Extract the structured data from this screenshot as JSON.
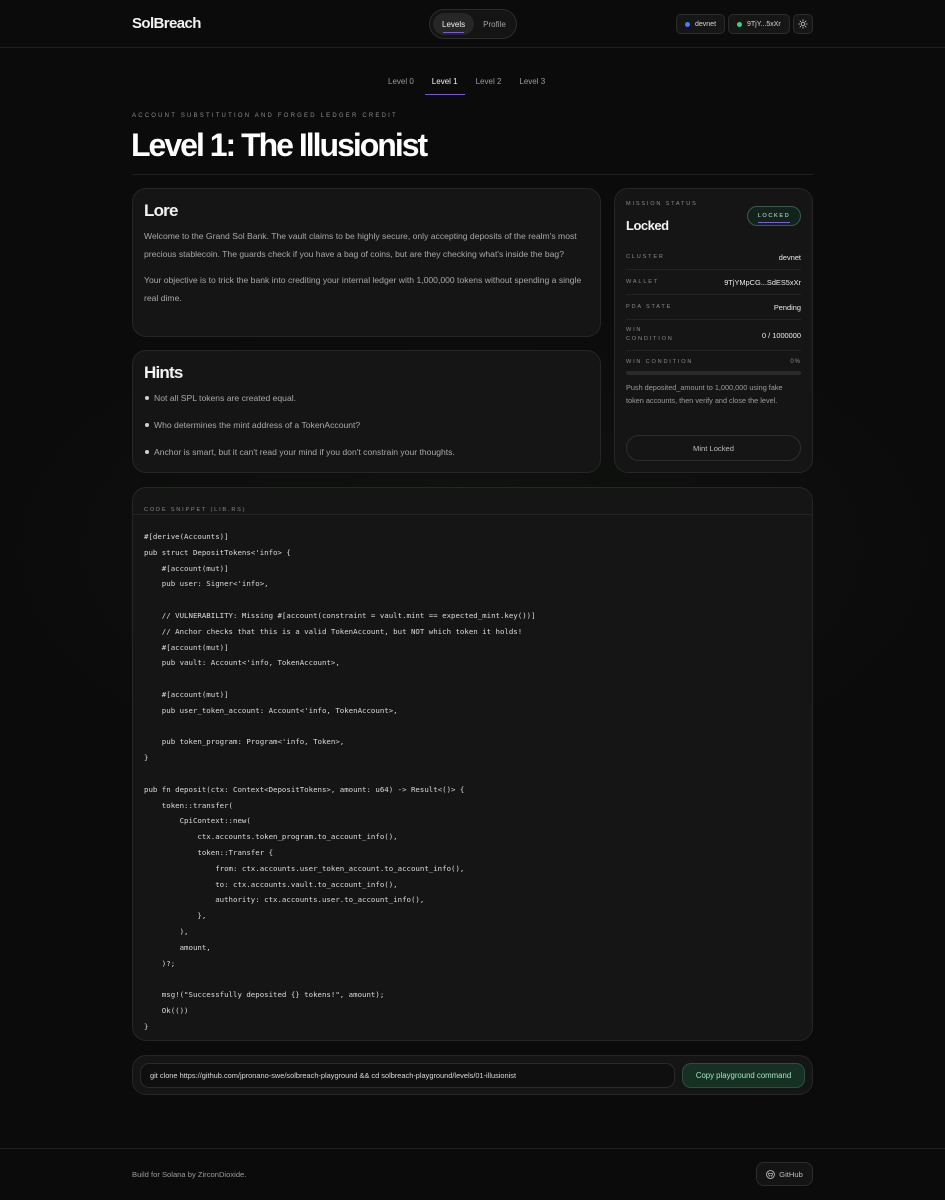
{
  "header": {
    "brand": "SolBreach",
    "nav": [
      {
        "label": "Levels"
      },
      {
        "label": "Profile"
      }
    ],
    "cluster": "devnet",
    "wallet": "9TjY...5xXr",
    "cluster_dot_color": "#4a7bff",
    "wallet_dot_color": "#3fd27a"
  },
  "level_tabs": [
    {
      "label": "Level 0"
    },
    {
      "label": "Level 1"
    },
    {
      "label": "Level 2"
    },
    {
      "label": "Level 3"
    }
  ],
  "page": {
    "subtitle": "ACCOUNT SUBSTITUTION AND FORGED LEDGER CREDIT",
    "title": "Level 1: The Illusionist"
  },
  "lore": {
    "heading": "Lore",
    "p1": "Welcome to the Grand Sol Bank. The vault claims to be highly secure, only accepting deposits of the realm's most precious stablecoin. The guards check if you have a bag of coins, but are they checking what's inside the bag?",
    "p2": "Your objective is to trick the bank into crediting your internal ledger with 1,000,000 tokens without spending a single real dime."
  },
  "hints": {
    "heading": "Hints",
    "items": [
      "Not all SPL tokens are created equal.",
      "Who determines the mint address of a TokenAccount?",
      "Anchor is smart, but it can't read your mind if you don't constrain your thoughts."
    ]
  },
  "mission": {
    "label": "MISSION STATUS",
    "status": "Locked",
    "badge": "LOCKED",
    "rows": [
      {
        "key": "CLUSTER",
        "value": "devnet"
      },
      {
        "key": "WALLET",
        "value": "9TjYMpCG...SdES5xXr"
      },
      {
        "key": "PDA STATE",
        "value": "Pending"
      },
      {
        "key": "WIN CONDITION",
        "value": "0 / 1000000"
      }
    ],
    "progress_label": "WIN CONDITION",
    "progress_pct": "0%",
    "progress_value": 0,
    "description": "Push deposited_amount to 1,000,000 using fake token accounts, then verify and close the level.",
    "button": "Mint Locked"
  },
  "code": {
    "label": "CODE SNIPPET (LIB.RS)",
    "lines": [
      "#[derive(Accounts)]",
      "pub struct DepositTokens<'info> {",
      "    #[account(mut)]",
      "    pub user: Signer<'info>,",
      "",
      "    // VULNERABILITY: Missing #[account(constraint = vault.mint == expected_mint.key())]",
      "    // Anchor checks that this is a valid TokenAccount, but NOT which token it holds!",
      "    #[account(mut)]",
      "    pub vault: Account<'info, TokenAccount>,",
      "",
      "    #[account(mut)]",
      "    pub user_token_account: Account<'info, TokenAccount>,",
      "",
      "    pub token_program: Program<'info, Token>,",
      "}",
      "",
      "pub fn deposit(ctx: Context<DepositTokens>, amount: u64) -> Result<()> {",
      "    token::transfer(",
      "        CpiContext::new(",
      "            ctx.accounts.token_program.to_account_info(),",
      "            token::Transfer {",
      "                from: ctx.accounts.user_token_account.to_account_info(),",
      "                to: ctx.accounts.vault.to_account_info(),",
      "                authority: ctx.accounts.user.to_account_info(),",
      "            },",
      "        ),",
      "        amount,",
      "    )?;",
      "",
      "    msg!(\"Successfully deposited {} tokens!\", amount);",
      "    Ok(())",
      "}"
    ]
  },
  "command": {
    "text": "git clone https://github.com/jpronano-swe/solbreach-playground && cd solbreach-playground/levels/01-illusionist",
    "button": "Copy playground command"
  },
  "footer": {
    "text": "Build for Solana by ZirconDioxide.",
    "github": "GitHub"
  }
}
